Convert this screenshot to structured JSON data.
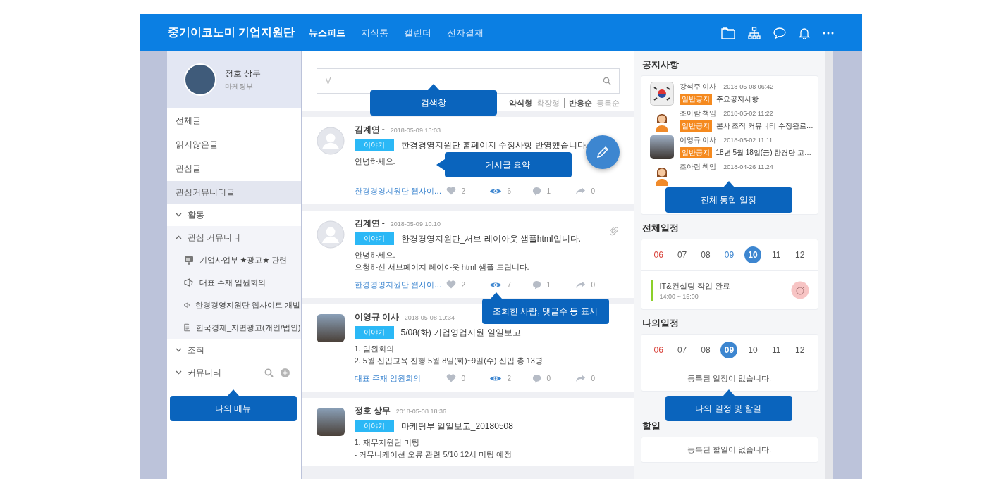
{
  "header": {
    "logo": "중기이코노미 기업지원단",
    "nav": [
      {
        "label": "뉴스피드",
        "selected": true
      },
      {
        "label": "지식통",
        "selected": false
      },
      {
        "label": "캘린더",
        "selected": false
      },
      {
        "label": "전자결재",
        "selected": false
      }
    ]
  },
  "sidebar": {
    "profile": {
      "name": "정호 상무",
      "dept": "마케팅부"
    },
    "items": [
      {
        "kind": "link",
        "label": "전체글",
        "selected": false
      },
      {
        "kind": "link",
        "label": "읽지않은글",
        "selected": false
      },
      {
        "kind": "link",
        "label": "관심글",
        "selected": false
      },
      {
        "kind": "link",
        "label": "관심커뮤니티글",
        "selected": true
      },
      {
        "kind": "group",
        "label": "활동",
        "expanded": false
      },
      {
        "kind": "group",
        "label": "관심 커뮤니티",
        "expanded": true,
        "children": [
          {
            "kind": "board",
            "label": "기업사업부 ★광고★ 관련"
          },
          {
            "kind": "meeting",
            "label": "대표 주재 임원회의"
          },
          {
            "kind": "meeting",
            "label": "한경경영지원단 웹사이트 개발"
          },
          {
            "kind": "file",
            "label": "한국경제_지면광고(개인/법인)"
          }
        ]
      },
      {
        "kind": "group",
        "label": "조직",
        "expanded": false
      },
      {
        "kind": "group",
        "label": "커뮤니티",
        "expanded": false,
        "tools": true
      }
    ]
  },
  "feed": {
    "search": {
      "placeholder": "V"
    },
    "sort_groups": [
      [
        {
          "label": "약식형",
          "selected": true
        },
        {
          "label": "확장형",
          "selected": false
        }
      ],
      [
        {
          "label": "반응순",
          "selected": true
        },
        {
          "label": "등록순",
          "selected": false
        }
      ]
    ],
    "posts": [
      {
        "avatar": {
          "kind": "default"
        },
        "author": "김계연 -",
        "date": "2018-05-09 13:03",
        "tag": "이야기",
        "title": "한경경영지원단 홈페이지 수정사항 반영했습니다.",
        "lines": [
          "안녕하세요."
        ],
        "attachment": false,
        "community": "한경경영지원단 웹사이…",
        "stats": [
          {
            "kind": "like",
            "count": "2"
          },
          {
            "kind": "view",
            "count": "6"
          },
          {
            "kind": "comment",
            "count": "1"
          },
          {
            "kind": "share",
            "count": "0"
          }
        ]
      },
      {
        "avatar": {
          "kind": "default"
        },
        "author": "김계연 -",
        "date": "2018-05-09 10:10",
        "tag": "이야기",
        "title": "한경경영지원단_서브 레이아웃 샘플html입니다.",
        "lines": [
          "안녕하세요.",
          "요청하신 서브페이지 레이아웃 html 샘플 드립니다."
        ],
        "attachment": true,
        "community": "한경경영지원단 웹사이…",
        "stats": [
          {
            "kind": "like",
            "count": "2"
          },
          {
            "kind": "view",
            "count": "7"
          },
          {
            "kind": "comment",
            "count": "1"
          },
          {
            "kind": "share",
            "count": "0"
          }
        ]
      },
      {
        "avatar": {
          "kind": "photo"
        },
        "author": "이영규 이사",
        "date": "2018-05-08 19:34",
        "tag": "이야기",
        "title": "5/08(화) 기업영업지원 일일보고",
        "lines": [
          "1. 임원회의",
          "2. 5월 신입교육 진행 5월 8일(화)~9일(수) 신입 총 13명"
        ],
        "attachment": false,
        "community": "대표 주재 임원회의",
        "stats": [
          {
            "kind": "like",
            "count": "0"
          },
          {
            "kind": "view",
            "count": "2"
          },
          {
            "kind": "comment",
            "count": "0"
          },
          {
            "kind": "share",
            "count": "0"
          }
        ]
      },
      {
        "avatar": {
          "kind": "photo"
        },
        "author": "정호 상무",
        "date": "2018-05-08 18:36",
        "tag": "이야기",
        "title": "마케팅부 일일보고_20180508",
        "lines": [
          "1. 재무지원단 미팅",
          "- 커뮤니케이션 오류 관련 5/10 12시 미팅 예정"
        ],
        "attachment": false
      }
    ]
  },
  "right": {
    "notices": {
      "title": "공지사항",
      "items": [
        {
          "avatar": {
            "kind": "flag"
          },
          "author": "강석주 이사",
          "date": "2018-05-08 06:42",
          "tag": "일반공지",
          "title": "주요공지사항"
        },
        {
          "avatar": {
            "kind": "illustration"
          },
          "author": "조아람 책임",
          "date": "2018-05-02 11:22",
          "tag": "일반공지",
          "title": "본사 조직 커뮤니티 수정완료…"
        },
        {
          "avatar": {
            "kind": "photo"
          },
          "author": "이영규 이사",
          "date": "2018-05-02 11:11",
          "tag": "일반공지",
          "title": "18년 5월 18일(금) 한경단 고…"
        },
        {
          "avatar": {
            "kind": "illustration"
          },
          "author": "조아람 책임",
          "date": "2018-04-26 11:24"
        }
      ]
    },
    "all_schedule": {
      "title": "전체일정",
      "days": [
        {
          "label": "06",
          "color": "#d9443c",
          "selected": false
        },
        {
          "label": "07",
          "color": "#555555",
          "selected": false
        },
        {
          "label": "08",
          "color": "#555555",
          "selected": false
        },
        {
          "label": "09",
          "color": "#3d86d0",
          "selected": false
        },
        {
          "label": "10",
          "selected": true
        },
        {
          "label": "11",
          "color": "#555555",
          "selected": false
        },
        {
          "label": "12",
          "color": "#555555",
          "selected": false
        }
      ],
      "events": [
        {
          "title": "IT&컨설팅 작업 완료",
          "time": "14:00 ~ 15:00",
          "color": "#8cd02a"
        }
      ]
    },
    "my_schedule": {
      "title": "나의일정",
      "days": [
        {
          "label": "06",
          "color": "#d9443c",
          "selected": false
        },
        {
          "label": "07",
          "color": "#555555",
          "selected": false
        },
        {
          "label": "08",
          "color": "#555555",
          "selected": false
        },
        {
          "label": "09",
          "selected": true
        },
        {
          "label": "10",
          "color": "#555555",
          "selected": false
        },
        {
          "label": "11",
          "color": "#555555",
          "selected": false
        },
        {
          "label": "12",
          "color": "#555555",
          "selected": false
        }
      ],
      "empty": "등록된 일정이 없습니다."
    },
    "todo": {
      "title": "할일",
      "empty": "등록된 할일이 없습니다."
    }
  },
  "callouts": [
    {
      "label": "검색창"
    },
    {
      "label": "게시글 요약"
    },
    {
      "label": "전체 통합 일정"
    },
    {
      "label": "조회한 사람, 댓글수 등 표시"
    },
    {
      "label": "나의 메뉴"
    },
    {
      "label": "나의 일정 및 할일"
    }
  ]
}
